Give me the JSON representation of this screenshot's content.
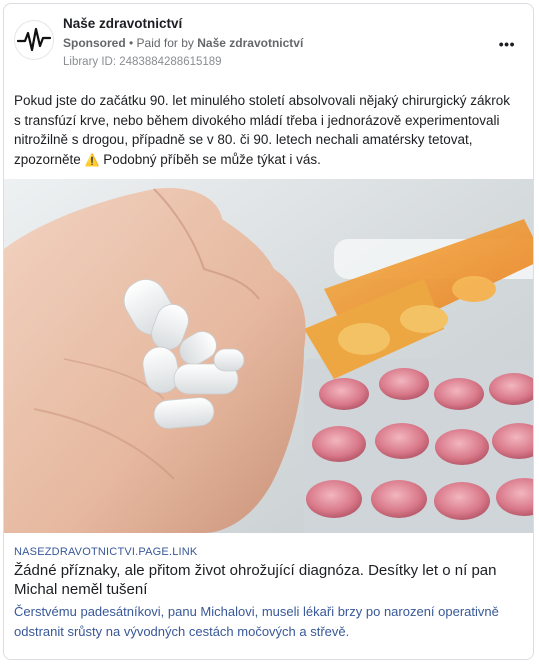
{
  "page": {
    "name": "Naše zdravotnictví"
  },
  "meta": {
    "sponsored": "Sponsored",
    "separator": " • ",
    "paid_for_prefix": "Paid for by ",
    "paid_for_name": "Naše zdravotnictví",
    "library_id": "Library ID: 2483884288615189"
  },
  "post": {
    "text": "Pokud jste do začátku 90. let minulého století absolvovali nějaký chirurgický zákrok s transfúzí krve, nebo během divokého mládí třeba i jednorázově experimentovali nitrožilně s drogou, případně se v 80. či 90. letech nechali amatérsky tetovat, zpozorněte",
    "warning_emoji": "⚠️",
    "text_end": " Podobný příběh se může týkat i vás."
  },
  "media": {
    "icon": "pills-in-hand-photo"
  },
  "link": {
    "domain": "NASEZDRAVOTNICTVI.PAGE.LINK",
    "headline": "Žádné příznaky, ale přitom život ohrožující diagnóza. Desítky let o ní pan Michal neměl tušení",
    "description": "Čerstvému padesátníkovi, panu Michalovi, museli lékaři brzy po narození operativně odstranit srůsty na vývodných cestách močových a střevě."
  },
  "more_icon": "more-horizontal-icon",
  "colors": {
    "link_blue": "#385898",
    "text": "#1c1e21",
    "muted": "#65676b"
  }
}
